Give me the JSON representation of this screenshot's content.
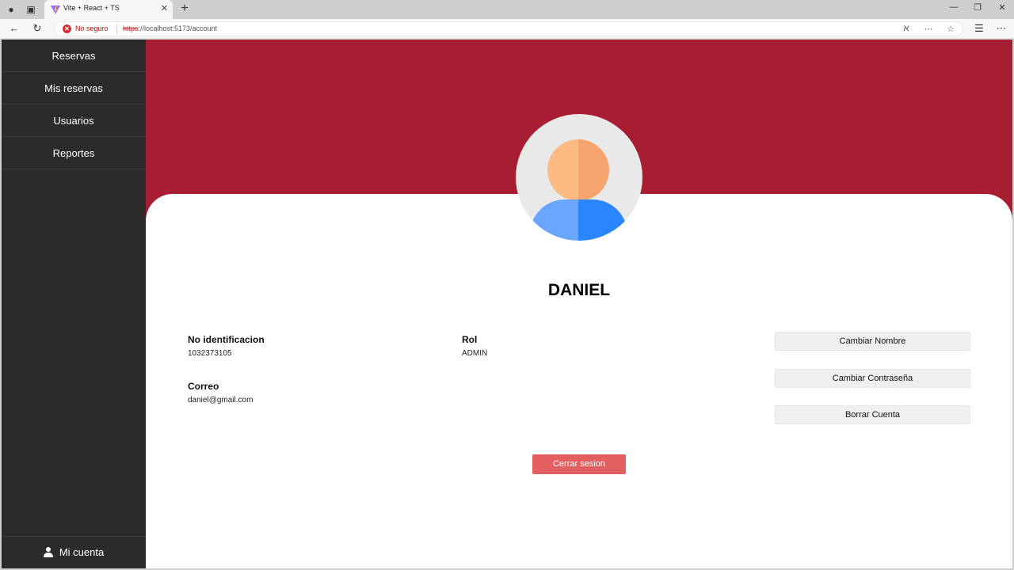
{
  "browser": {
    "tab_title": "Vite + React + TS",
    "insecure_label": "No seguro",
    "url_scheme": "https",
    "url_rest": "://localhost:5173/account"
  },
  "sidebar": {
    "items": [
      {
        "label": "Reservas"
      },
      {
        "label": "Mis reservas"
      },
      {
        "label": "Usuarios"
      },
      {
        "label": "Reportes"
      }
    ],
    "account_label": "Mi cuenta"
  },
  "profile": {
    "name": "DANIEL",
    "id_label": "No identificacion",
    "id_value": "1032373105",
    "role_label": "Rol",
    "role_value": "ADMIN",
    "email_label": "Correo",
    "email_value": "daniel@gmail.com"
  },
  "actions": {
    "change_name": "Cambiar Nombre",
    "change_password": "Cambiar Contraseña",
    "delete_account": "Borrar Cuenta",
    "logout": "Cerrar sesion"
  },
  "colors": {
    "banner": "#a71d31",
    "sidebar": "#2b2b2b",
    "logout": "#e45f5f"
  }
}
